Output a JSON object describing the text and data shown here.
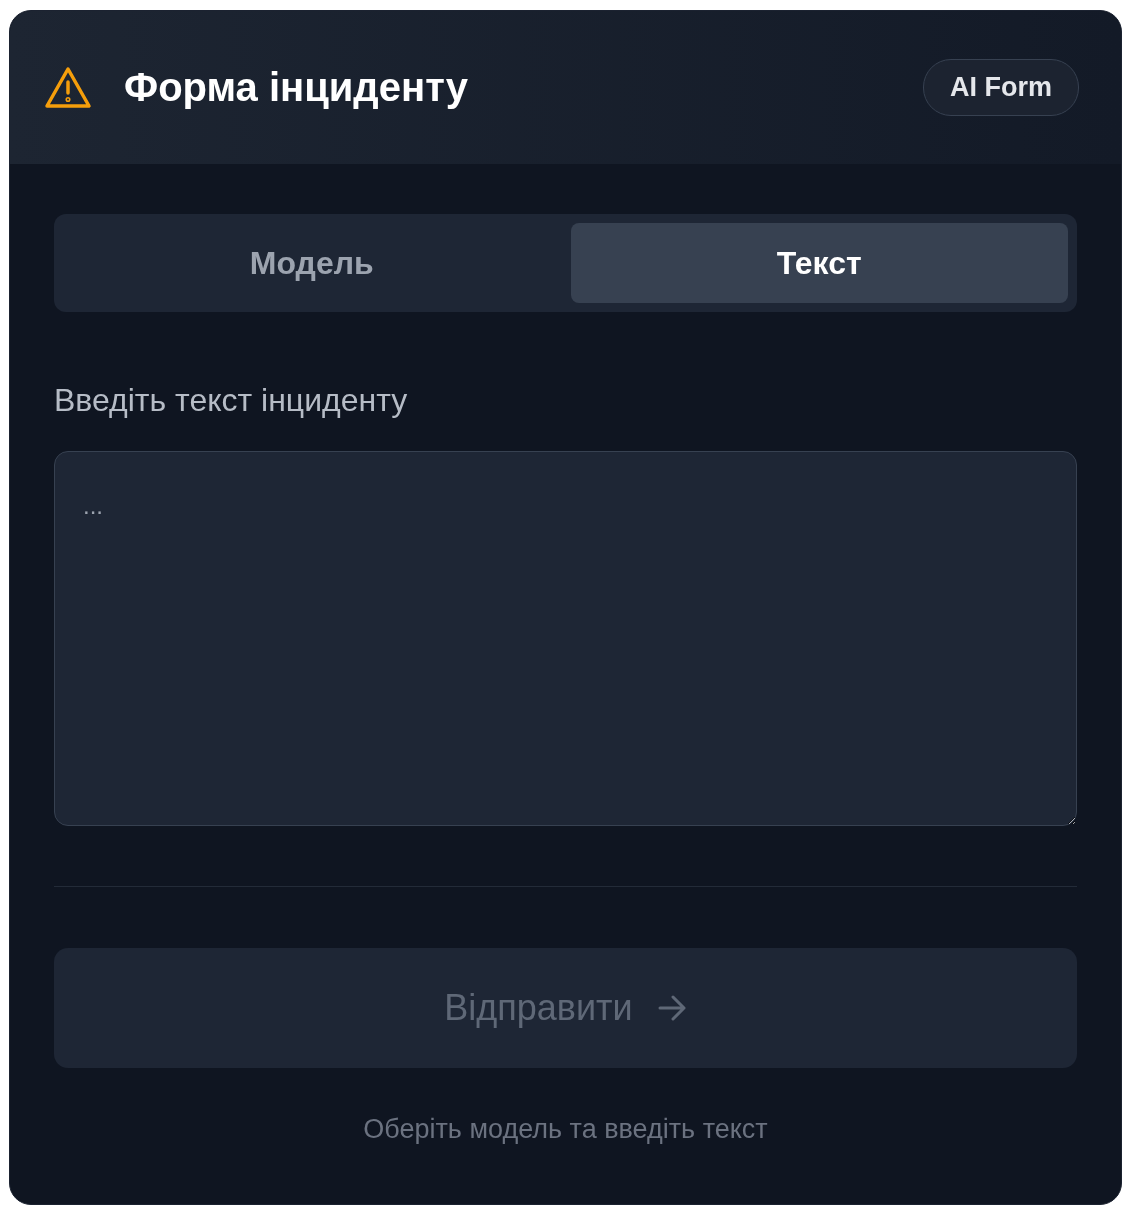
{
  "header": {
    "title": "Форма інциденту",
    "badge": "AI Form"
  },
  "tabs": [
    {
      "label": "Модель",
      "selected": false
    },
    {
      "label": "Текст",
      "selected": true
    }
  ],
  "field": {
    "label": "Введіть текст інциденту",
    "placeholder": "..."
  },
  "submit": {
    "label": "Відправити",
    "disabled": true
  },
  "hint": "Оберіть модель та введіть текст"
}
